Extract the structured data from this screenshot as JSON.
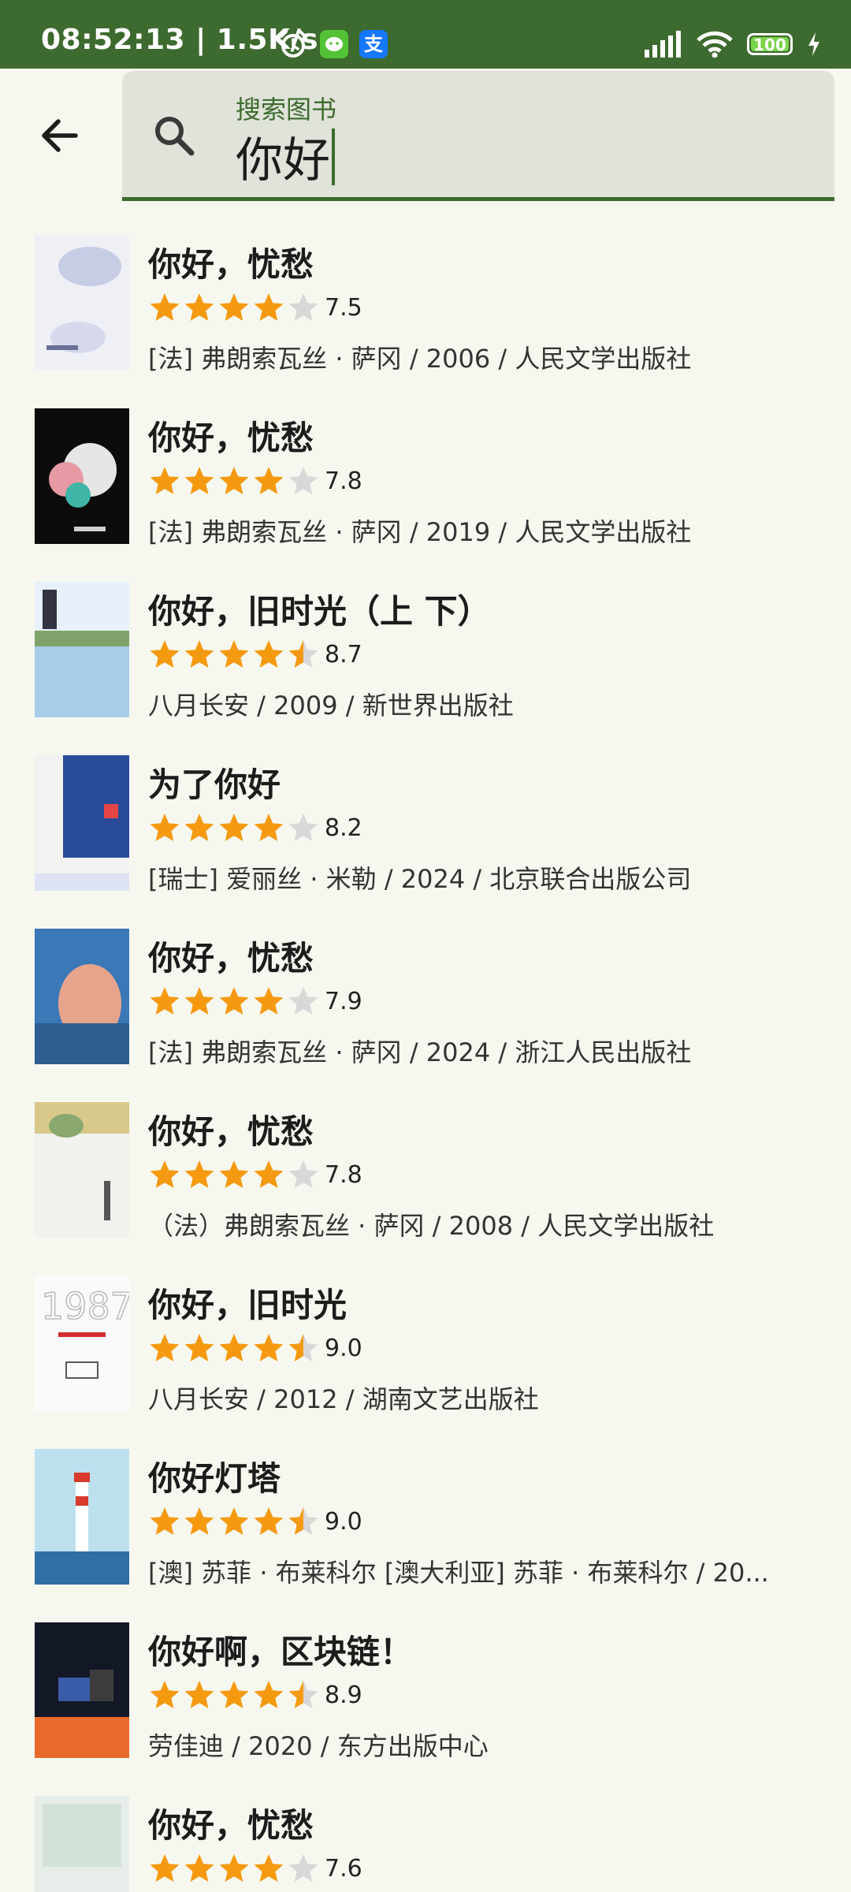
{
  "status_bar": {
    "time": "08:52:13 | 1.5K/s",
    "battery": "100",
    "alipay_label": "支"
  },
  "search": {
    "label": "搜索图书",
    "query": "你好"
  },
  "colors": {
    "accent": "#3d6a2e",
    "star": "#f59a10",
    "star_empty": "#d8d8d8"
  },
  "results": [
    {
      "title": "你好，忧愁",
      "rating": 7.5,
      "score": "7.5",
      "meta": "[法] 弗朗索瓦丝 · 萨冈 / 2006 / 人民文学出版社"
    },
    {
      "title": "你好，忧愁",
      "rating": 7.8,
      "score": "7.8",
      "meta": "[法] 弗朗索瓦丝 · 萨冈 / 2019 / 人民文学出版社"
    },
    {
      "title": "你好，旧时光（上 下）",
      "rating": 8.7,
      "score": "8.7",
      "meta": "八月长安 / 2009 / 新世界出版社"
    },
    {
      "title": "为了你好",
      "rating": 8.2,
      "score": "8.2",
      "meta": "[瑞士] 爱丽丝 · 米勒 / 2024 / 北京联合出版公司"
    },
    {
      "title": "你好，忧愁",
      "rating": 7.9,
      "score": "7.9",
      "meta": "[法] 弗朗索瓦丝 · 萨冈 / 2024 / 浙江人民出版社"
    },
    {
      "title": "你好，忧愁",
      "rating": 7.8,
      "score": "7.8",
      "meta": "（法）弗朗索瓦丝 · 萨冈 / 2008 / 人民文学出版社"
    },
    {
      "title": "你好，旧时光",
      "rating": 9.0,
      "score": "9.0",
      "meta": "八月长安 / 2012 / 湖南文艺出版社"
    },
    {
      "title": "你好灯塔",
      "rating": 9.0,
      "score": "9.0",
      "meta": "[澳] 苏菲 · 布莱科尔 [澳大利亚] 苏菲 · 布莱科尔 / 20..."
    },
    {
      "title": "你好啊，区块链！",
      "rating": 8.9,
      "score": "8.9",
      "meta": "劳佳迪 / 2020 / 东方出版中心"
    },
    {
      "title": "你好，忧愁",
      "rating": 7.6,
      "score": "7.6",
      "meta": ""
    }
  ]
}
